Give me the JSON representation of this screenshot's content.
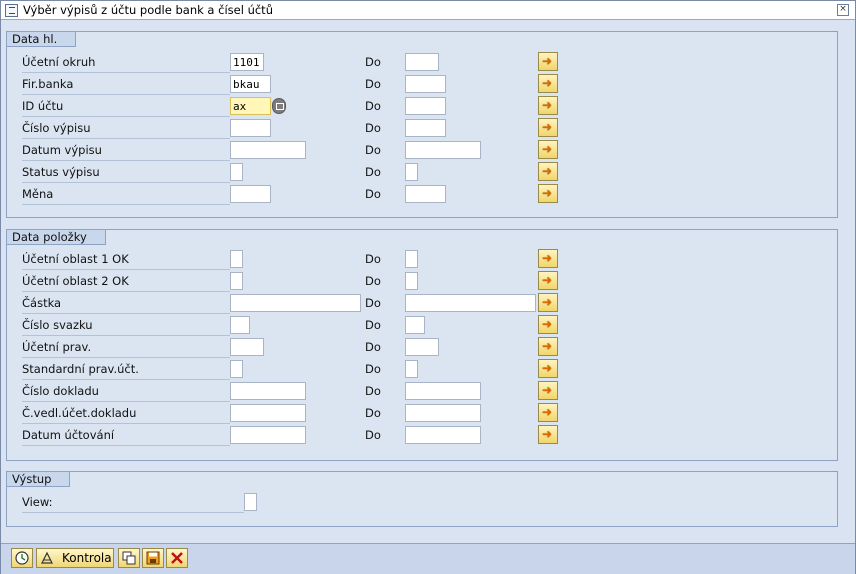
{
  "window": {
    "title": "Výběr výpisů z účtu podle bank a čísel účtů"
  },
  "groups": {
    "data_hl": {
      "title": "Data hl.",
      "rows": [
        {
          "label": "Účetní okruh",
          "from": "1101",
          "to": ""
        },
        {
          "label": "Fir.banka",
          "from": "bkau",
          "to": ""
        },
        {
          "label": "ID účtu",
          "from": "ax",
          "to": ""
        },
        {
          "label": "Číslo výpisu",
          "from": "",
          "to": ""
        },
        {
          "label": "Datum výpisu",
          "from": "",
          "to": ""
        },
        {
          "label": "Status výpisu",
          "from": "",
          "to": ""
        },
        {
          "label": "Měna",
          "from": "",
          "to": ""
        }
      ]
    },
    "data_polozky": {
      "title": "Data položky",
      "rows": [
        {
          "label": "Účetní oblast 1 OK",
          "from": "",
          "to": ""
        },
        {
          "label": "Účetní oblast 2 OK",
          "from": "",
          "to": ""
        },
        {
          "label": "Částka",
          "from": "",
          "to": ""
        },
        {
          "label": "Číslo svazku",
          "from": "",
          "to": ""
        },
        {
          "label": "Účetní prav.",
          "from": "",
          "to": ""
        },
        {
          "label": "Standardní prav.účt.",
          "from": "",
          "to": ""
        },
        {
          "label": "Číslo dokladu",
          "from": "",
          "to": ""
        },
        {
          "label": "Č.vedl.účet.dokladu",
          "from": "",
          "to": ""
        },
        {
          "label": "Datum účtování",
          "from": "",
          "to": ""
        }
      ]
    },
    "vystup": {
      "title": "Výstup",
      "view_label": "View:",
      "view_value": ""
    }
  },
  "do_label": "Do",
  "toolbar": {
    "kontrola_label": "Kontrola"
  },
  "colors": {
    "accent": "#f0d674",
    "background": "#d9e3f1",
    "active_field": "#fff6b8"
  }
}
